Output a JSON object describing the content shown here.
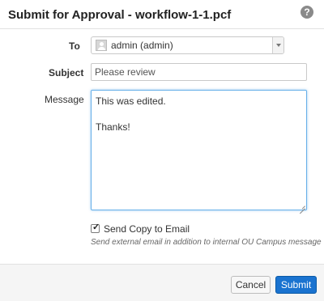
{
  "dialog": {
    "title": "Submit for Approval - workflow-1-1.pcf",
    "help_icon": "question-circle-icon",
    "help_glyph": "?"
  },
  "form": {
    "to_label": "To",
    "to_value": "admin (admin)",
    "subject_label": "Subject",
    "subject_value": "Please review",
    "message_label": "Message",
    "message_value": "This was edited.\n\nThanks!",
    "send_copy_checked": true,
    "send_copy_label": "Send Copy to Email",
    "send_copy_hint": "Send external email in addition to internal OU Campus message"
  },
  "footer": {
    "cancel_label": "Cancel",
    "submit_label": "Submit"
  },
  "colors": {
    "primary": "#1a73d0",
    "focus_border": "#66afe9"
  }
}
